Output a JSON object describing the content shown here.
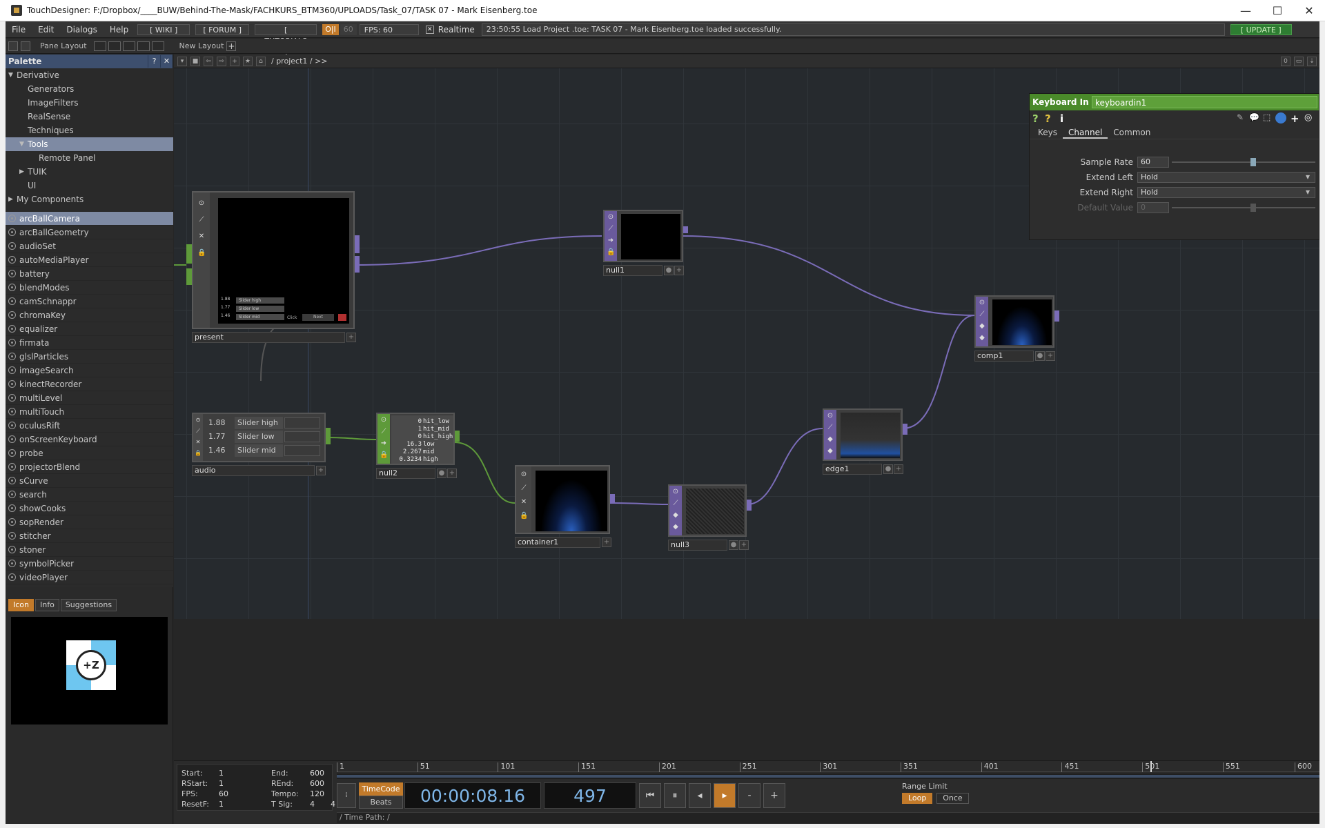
{
  "window": {
    "title": "TouchDesigner: F:/Dropbox/____BUW/Behind-The-Mask/FACHKURS_BTM360/UPLOADS/Task_07/TASK 07 - Mark Eisenberg.toe",
    "min": "—",
    "max": "☐",
    "close": "✕"
  },
  "menubar": {
    "items": [
      "File",
      "Edit",
      "Dialogs",
      "Help"
    ],
    "wiki": "[ WIKI ]",
    "forum": "[ FORUM ]",
    "tutorials": "[ TUTORIALS ]",
    "oi": "O|I",
    "fps_target": "60",
    "fps": "FPS:  60",
    "realtime": "Realtime",
    "status": "23:50:55 Load Project .toe: TASK 07 - Mark Eisenberg.toe loaded successfully.",
    "update": "[ UPDATE ]"
  },
  "panebar": {
    "pane_layout": "Pane Layout",
    "new_layout": "New Layout",
    "plus": "+"
  },
  "palette": {
    "title": "Palette",
    "help": "?",
    "close": "✕",
    "tree": [
      {
        "label": "Derivative",
        "indent": 0,
        "caret": "down"
      },
      {
        "label": "Generators",
        "indent": 2,
        "caret": ""
      },
      {
        "label": "ImageFilters",
        "indent": 2,
        "caret": ""
      },
      {
        "label": "RealSense",
        "indent": 2,
        "caret": ""
      },
      {
        "label": "Techniques",
        "indent": 2,
        "caret": ""
      },
      {
        "label": "Tools",
        "indent": 1,
        "caret": "down",
        "selected": true
      },
      {
        "label": "Remote Panel",
        "indent": 3,
        "caret": ""
      },
      {
        "label": "TUIK",
        "indent": 1,
        "caret": "right"
      },
      {
        "label": "UI",
        "indent": 2,
        "caret": ""
      },
      {
        "label": "My Components",
        "indent": 0,
        "caret": "right"
      }
    ],
    "components": [
      "arcBallCamera",
      "arcBallGeometry",
      "audioSet",
      "autoMediaPlayer",
      "battery",
      "blendModes",
      "camSchnappr",
      "chromaKey",
      "equalizer",
      "firmata",
      "glslParticles",
      "imageSearch",
      "kinectRecorder",
      "multiLevel",
      "multiTouch",
      "oculusRift",
      "onScreenKeyboard",
      "probe",
      "projectorBlend",
      "sCurve",
      "search",
      "showCooks",
      "sopRender",
      "stitcher",
      "stoner",
      "symbolPicker",
      "videoPlayer"
    ],
    "selected_component": "arcBallCamera",
    "tabs": [
      "Icon",
      "Info",
      "Suggestions"
    ],
    "preview_symbol": "+Z"
  },
  "network": {
    "path": "/ project1 / >>",
    "nodes": {
      "present": "present",
      "null1": "null1",
      "comp1": "comp1",
      "audio": "audio",
      "null2": "null2",
      "container1": "container1",
      "null3": "null3",
      "edge1": "edge1"
    },
    "present_overlay": {
      "rows": [
        {
          "num": "1.88",
          "label": "Slider high"
        },
        {
          "num": "1.77",
          "label": "Slider low"
        },
        {
          "num": "1.46",
          "label": "Slider mid"
        }
      ],
      "click": "Click",
      "next": "Next"
    },
    "audio_rows": [
      {
        "num": "1.88",
        "label": "Slider high"
      },
      {
        "num": "1.77",
        "label": "Slider low"
      },
      {
        "num": "1.46",
        "label": "Slider mid"
      }
    ],
    "null2_channels": [
      {
        "v": "0",
        "n": "hit_low"
      },
      {
        "v": "1",
        "n": "hit_mid"
      },
      {
        "v": "0",
        "n": "hit_high"
      },
      {
        "v": "16.3",
        "n": "low"
      },
      {
        "v": "2.267",
        "n": "mid"
      },
      {
        "v": "0.3234",
        "n": "high"
      }
    ]
  },
  "params": {
    "op_type": "Keyboard In",
    "op_name": "keyboardin1",
    "tabs": [
      "Keys",
      "Channel",
      "Common"
    ],
    "active_tab": "Channel",
    "rows": [
      {
        "label": "Sample Rate",
        "value": "60",
        "kind": "slider",
        "slider_fraction": 0.55
      },
      {
        "label": "Extend Left",
        "value": "Hold",
        "kind": "menu"
      },
      {
        "label": "Extend Right",
        "value": "Hold",
        "kind": "menu"
      },
      {
        "label": "Default Value",
        "value": "0",
        "kind": "slider",
        "dim": true,
        "slider_fraction": 0.55
      }
    ]
  },
  "timeline": {
    "info": [
      {
        "k": "Start:",
        "v": "1",
        "k2": "End:",
        "v2": "600"
      },
      {
        "k": "RStart:",
        "v": "1",
        "k2": "REnd:",
        "v2": "600"
      },
      {
        "k": "FPS:",
        "v": "60",
        "k2": "Tempo:",
        "v2": "120"
      },
      {
        "k": "ResetF:",
        "v": "1",
        "k2": "T Sig:",
        "v2": "4",
        "v3": "4"
      }
    ],
    "ticks": [
      "1",
      "51",
      "101",
      "151",
      "201",
      "251",
      "301",
      "351",
      "401",
      "451",
      "501",
      "551",
      "600"
    ],
    "current_frame_fraction": 0.828,
    "timecode_label": "TimeCode",
    "beats_label": "Beats",
    "timecode": "00:00:08.16",
    "frame": "497",
    "range_limit": "Range Limit",
    "loop": "Loop",
    "once": "Once",
    "time_path": "/ Time Path: /",
    "buttons": {
      "rewind": "⏮",
      "pause": "⏸",
      "back": "◂",
      "play": "▸",
      "minus": "-",
      "plus": "+"
    }
  }
}
